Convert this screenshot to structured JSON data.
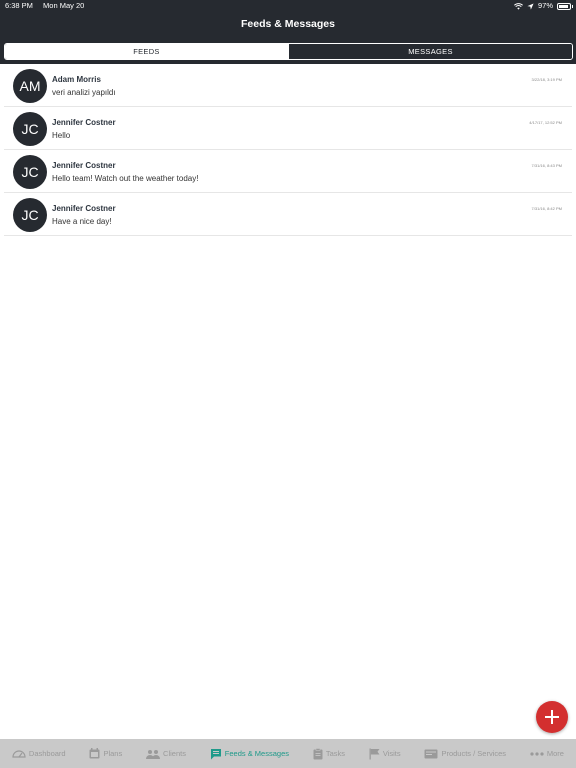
{
  "status_bar": {
    "time": "6:38 PM",
    "date": "Mon May 20",
    "battery": "97%"
  },
  "header": {
    "title": "Feeds & Messages"
  },
  "segments": {
    "feeds": "FEEDS",
    "messages": "MESSAGES"
  },
  "feeds": [
    {
      "initials": "AM",
      "name": "Adam Morris",
      "message": "veri analizi yapıldı",
      "time": "3/22/18, 3:19 PM"
    },
    {
      "initials": "JC",
      "name": "Jennifer Costner",
      "message": "Hello",
      "time": "4/17/17, 12:52 PM"
    },
    {
      "initials": "JC",
      "name": "Jennifer Costner",
      "message": "Hello team! Watch out the weather today!",
      "time": "7/31/16, 8:43 PM"
    },
    {
      "initials": "JC",
      "name": "Jennifer Costner",
      "message": "Have a nice day!",
      "time": "7/31/16, 8:42 PM"
    }
  ],
  "fab": {
    "icon": "plus-icon",
    "color": "#d32f2f"
  },
  "tabbar": {
    "items": [
      {
        "label": "Dashboard",
        "icon": "dashboard-icon"
      },
      {
        "label": "Plans",
        "icon": "calendar-icon"
      },
      {
        "label": "Clients",
        "icon": "clients-icon"
      },
      {
        "label": "Feeds & Messages",
        "icon": "chat-icon"
      },
      {
        "label": "Tasks",
        "icon": "clipboard-icon"
      },
      {
        "label": "Visits",
        "icon": "flag-icon"
      },
      {
        "label": "Products / Services",
        "icon": "products-icon"
      },
      {
        "label": "More",
        "icon": "more-icon"
      }
    ],
    "active_color": "#1f9a8a"
  },
  "colors": {
    "header_bg": "#262a30",
    "tabbar_bg": "#c9c9c9"
  }
}
